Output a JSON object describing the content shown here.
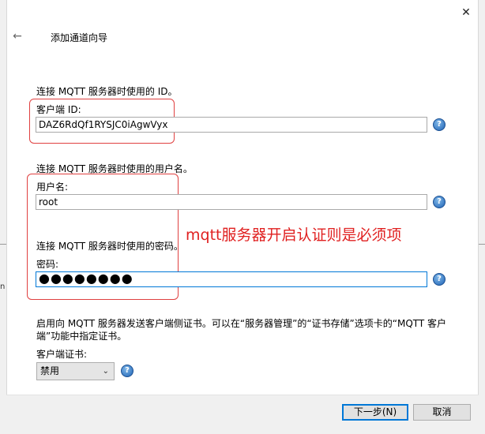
{
  "dialog": {
    "title": "添加通道向导",
    "close_glyph": "✕",
    "back_glyph": "←"
  },
  "client_id": {
    "description": "连接 MQTT 服务器时使用的 ID。",
    "label": "客户端 ID:",
    "value": "DAZ6RdQf1RYSJC0iAgwVyx"
  },
  "username": {
    "description": "连接 MQTT 服务器时使用的用户名。",
    "label": "用户名:",
    "value": "root"
  },
  "password": {
    "description": "连接 MQTT 服务器时使用的密码。",
    "label": "密码:",
    "value": "●●●●●●●●"
  },
  "annotation": {
    "text": "mqtt服务器开启认证则是必须项",
    "color": "#e02020"
  },
  "certificate": {
    "description_line1": "启用向 MQTT 服务器发送客户端侧证书。可以在“服务器管理”的“证书存储”选项卡的“MQTT 客户",
    "description_line2": "端”功能中指定证书。",
    "label": "客户端证书:",
    "selected": "禁用"
  },
  "footer": {
    "next_label": "下一步(N)",
    "cancel_label": "取消"
  },
  "icons": {
    "help": "help-icon",
    "close": "close-icon",
    "back": "back-arrow-icon",
    "dropdown": "chevron-down-icon"
  },
  "help_glyph": "?",
  "colors": {
    "focus_border": "#0078d7",
    "annotation_box": "#e04040"
  }
}
